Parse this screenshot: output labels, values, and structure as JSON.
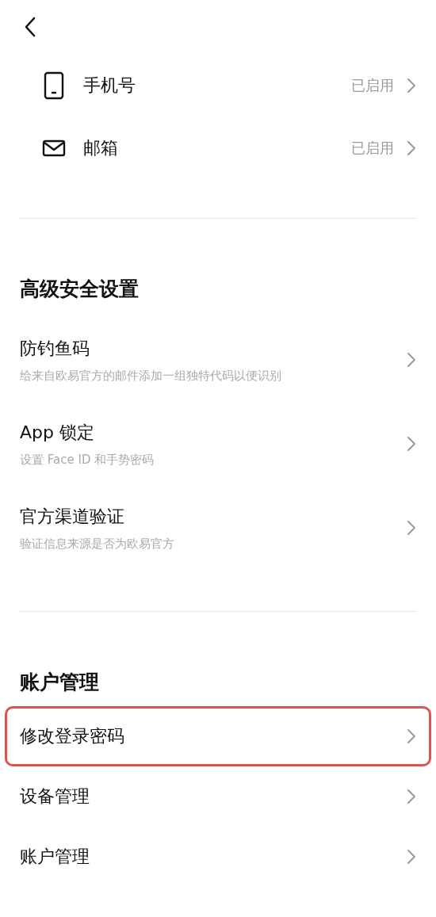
{
  "contact_methods": [
    {
      "kind": "phone",
      "label": "手机号",
      "status": "已启用"
    },
    {
      "kind": "email",
      "label": "邮箱",
      "status": "已启用"
    }
  ],
  "sections": [
    {
      "title": "高级安全设置",
      "items": [
        {
          "label": "防钓鱼码",
          "description": "给来自欧易官方的邮件添加一组独特代码以便识别",
          "highlighted": false
        },
        {
          "label": "App 锁定",
          "description": "设置 Face ID 和手势密码",
          "highlighted": false
        },
        {
          "label": "官方渠道验证",
          "description": "验证信息来源是否为欧易官方",
          "highlighted": false
        }
      ]
    },
    {
      "title": "账户管理",
      "items": [
        {
          "label": "修改登录密码",
          "highlighted": true
        },
        {
          "label": "设备管理",
          "highlighted": false
        },
        {
          "label": "账户管理",
          "highlighted": false
        }
      ]
    }
  ]
}
